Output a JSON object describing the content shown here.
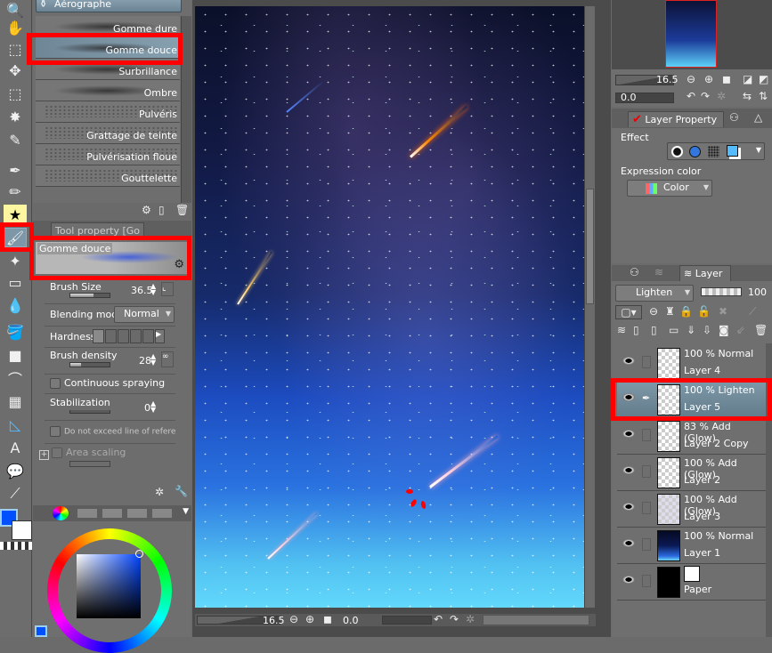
{
  "toolbar": {
    "tools": [
      {
        "name": "zoom-tool",
        "glyph": "🔍"
      },
      {
        "name": "hand-tool",
        "glyph": "✋"
      },
      {
        "name": "object-tool",
        "glyph": "⬚"
      },
      {
        "name": "move-tool",
        "glyph": "✥"
      },
      {
        "name": "selection-tool",
        "glyph": "⬚"
      },
      {
        "name": "auto-select-tool",
        "glyph": "✸"
      },
      {
        "name": "eyedropper-tool",
        "glyph": "✎"
      },
      {
        "name": "pen-tool",
        "glyph": "✒"
      },
      {
        "name": "pencil-tool",
        "glyph": "✏"
      },
      {
        "name": "decoration-tool",
        "glyph": "★"
      },
      {
        "name": "airbrush-tool",
        "glyph": "🖌"
      },
      {
        "name": "sparkle-tool",
        "glyph": "✦"
      },
      {
        "name": "eraser-tool",
        "glyph": "▭"
      },
      {
        "name": "blend-tool",
        "glyph": "💧"
      },
      {
        "name": "fill-tool",
        "glyph": "🪣"
      },
      {
        "name": "gradient-tool",
        "glyph": "■"
      },
      {
        "name": "figure-tool",
        "glyph": "⌒"
      },
      {
        "name": "frame-tool",
        "glyph": "▦"
      },
      {
        "name": "ruler-tool",
        "glyph": "◺"
      },
      {
        "name": "text-tool",
        "glyph": "A"
      },
      {
        "name": "balloon-tool",
        "glyph": "💬"
      },
      {
        "name": "correct-line-tool",
        "glyph": "⟋"
      }
    ]
  },
  "subtool": {
    "group_label": "Aérographe",
    "brushes": [
      {
        "label": "Gomme dure",
        "type": "stroke"
      },
      {
        "label": "Gomme douce",
        "type": "stroke",
        "selected": true
      },
      {
        "label": "Surbrillance",
        "type": "stroke"
      },
      {
        "label": "Ombre",
        "type": "stroke"
      },
      {
        "label": "Pulvéris",
        "type": "spray"
      },
      {
        "label": "Grattage de teinte",
        "type": "spray"
      },
      {
        "label": "Pulvérisation floue",
        "type": "spray"
      },
      {
        "label": "Gouttelette",
        "type": "spray"
      }
    ]
  },
  "tool_property": {
    "tab_label": "Tool property [Go",
    "preview_label": "Gomme douce",
    "brush_size_label": "Brush Size",
    "brush_size_value": "36.5",
    "blending_mode_label": "Blending mode",
    "blending_mode_value": "Normal",
    "hardness_label": "Hardness",
    "brush_density_label": "Brush density",
    "brush_density_value": "28",
    "continuous_spraying_label": "Continuous spraying",
    "stabilization_label": "Stabilization",
    "stabilization_value": "0",
    "do_not_exceed_label": "Do not exceed line of reference la",
    "area_scaling_label": "Area scaling"
  },
  "color": {
    "main_color": "#0050ff",
    "sub_color": "#ffffff"
  },
  "status": {
    "zoom_value": "16.5",
    "rotation_value": "0.0"
  },
  "navigator": {
    "zoom_value": "16.5",
    "rotation_value": "0.0"
  },
  "layer_property": {
    "tab_label": "Layer Property",
    "effect_label": "Effect",
    "expression_color_label": "Expression color",
    "expression_color_value": "Color"
  },
  "layer_panel": {
    "tab_label": "Layer",
    "blend_mode": "Lighten",
    "opacity": "100",
    "layers": [
      {
        "mode": "100 % Normal",
        "name": "Layer 4",
        "thumb": "transparent"
      },
      {
        "mode": "100 % Lighten",
        "name": "Layer 5",
        "thumb": "transparent",
        "selected": true
      },
      {
        "mode": "83 % Add (Glow)",
        "name": "Layer 2 Copy",
        "thumb": "transparent"
      },
      {
        "mode": "100 % Add (Glow)",
        "name": "Layer 2",
        "thumb": "transparent"
      },
      {
        "mode": "100 % Add (Glow)",
        "name": "Layer 3",
        "thumb": "cloudy"
      },
      {
        "mode": "100 % Normal",
        "name": "Layer 1",
        "thumb": "gradient"
      },
      {
        "mode": "",
        "name": "Paper",
        "thumb": "black"
      }
    ]
  }
}
